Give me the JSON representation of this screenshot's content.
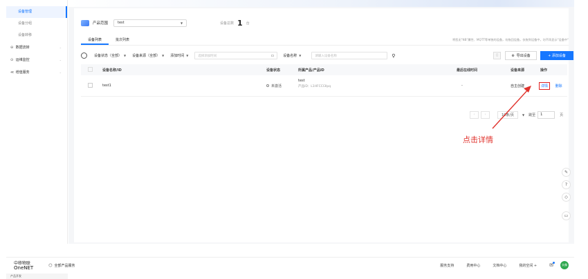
{
  "sidebar": {
    "sub_items": [
      {
        "label": "设备管理",
        "active": true
      },
      {
        "label": "设备分组",
        "active": false
      },
      {
        "label": "设备转移",
        "active": false
      }
    ],
    "items": [
      {
        "icon": "database-icon",
        "glyph": "⊖",
        "label": "数据流转"
      },
      {
        "icon": "monitor-icon",
        "glyph": "⊙",
        "label": "运维监控"
      },
      {
        "icon": "share-icon",
        "glyph": "≪",
        "label": "增值服务"
      }
    ],
    "bottom_label": "产品开发"
  },
  "header": {
    "product_label": "产品范围",
    "product_value": "test",
    "count_label": "设备总数",
    "count_value": "1",
    "count_unit": "台"
  },
  "tabs": [
    {
      "label": "设备列表",
      "active": true
    },
    {
      "label": "批次列表",
      "active": false
    }
  ],
  "hint": "将您无\"NB\"属性、MQTT等单独的设备，勿拖回设备，仅拖到设备中，勿不再显示\"设备中\"",
  "filters": {
    "status": "设备状态（全部）",
    "source": "设备来源（全部）",
    "time": "添加时间",
    "date_placeholder": "选择添加时间",
    "name": "设备名称",
    "name_placeholder": "请输入设备名称"
  },
  "buttons": {
    "export": "导出设备",
    "add": "+ 添加设备"
  },
  "table": {
    "headers": [
      "设备名称/ID",
      "设备状态",
      "所属产品/产品ID",
      "最后在线时间",
      "设备来源",
      "操作"
    ],
    "rows": [
      {
        "name": "test1",
        "status": "未激活",
        "product": "test",
        "product_id": "产品ID：L1HFCCI3lpq",
        "last_online": "-",
        "source": "自主创建",
        "op_detail": "详情",
        "op_delete": "删除"
      }
    ]
  },
  "pager": {
    "prev": "‹",
    "next": "›",
    "page_size": "10条/页",
    "jump_label": "跳至",
    "jump_value": "1",
    "page_suffix": "页"
  },
  "float_tools": [
    "✎",
    "?",
    "◇",
    "▭"
  ],
  "annotation": "点击详情",
  "topbar": {
    "logo_line1": "中移物联",
    "logo_line2": "OneNET",
    "all_products": "全部产品服务",
    "links": [
      "服务支持",
      "费用中心",
      "文档中心",
      "我的空间 +"
    ],
    "avatar_text": "头像"
  },
  "colors": {
    "accent": "#1677ff",
    "annotation": "#e0332d"
  }
}
